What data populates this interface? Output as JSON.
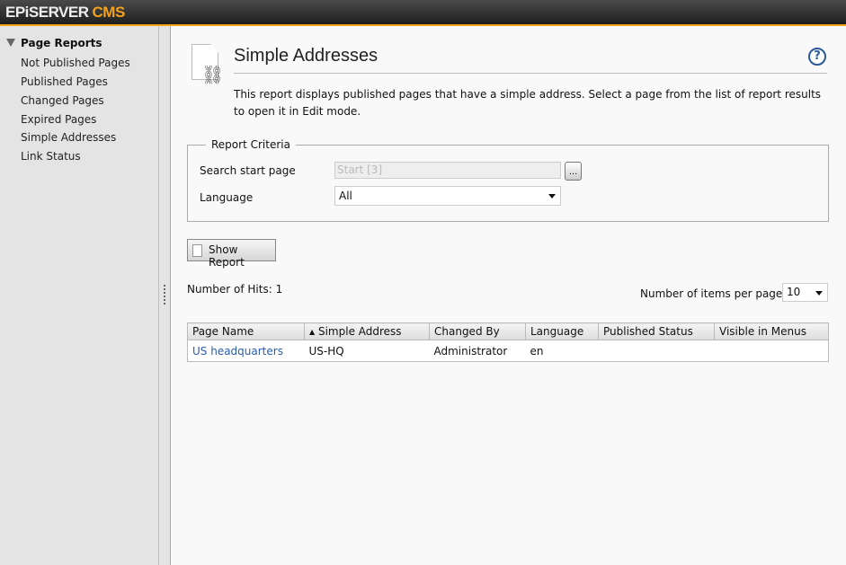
{
  "header": {
    "logo_main": "EPiSERVER",
    "logo_accent": "CMS"
  },
  "sidebar": {
    "heading": "Page Reports",
    "items": [
      {
        "label": "Not Published Pages"
      },
      {
        "label": "Published Pages"
      },
      {
        "label": "Changed Pages"
      },
      {
        "label": "Expired Pages"
      },
      {
        "label": "Simple Addresses"
      },
      {
        "label": "Link Status"
      }
    ]
  },
  "main": {
    "title": "Simple Addresses",
    "help": "?",
    "description": "This report displays published pages that have a simple address. Select a page from the list of report results to open it in Edit mode.",
    "criteria": {
      "legend": "Report Criteria",
      "start_label": "Search start page",
      "start_value": "Start [3]",
      "browse": "...",
      "language_label": "Language",
      "language_value": "All"
    },
    "show_report": "Show Report",
    "hits": "Number of Hits: 1",
    "items_per_page_label": "Number of items per page",
    "items_per_page": "10",
    "table": {
      "columns": [
        "Page Name",
        "Simple Address",
        "Changed By",
        "Language",
        "Published Status",
        "Visible in Menus"
      ],
      "sort_indicator": "▲",
      "rows": [
        [
          "US headquarters",
          "US-HQ",
          "Administrator",
          "en",
          "",
          ""
        ]
      ]
    }
  },
  "colors": {
    "accent": "#f4a11c",
    "link": "#2a5ab0"
  }
}
